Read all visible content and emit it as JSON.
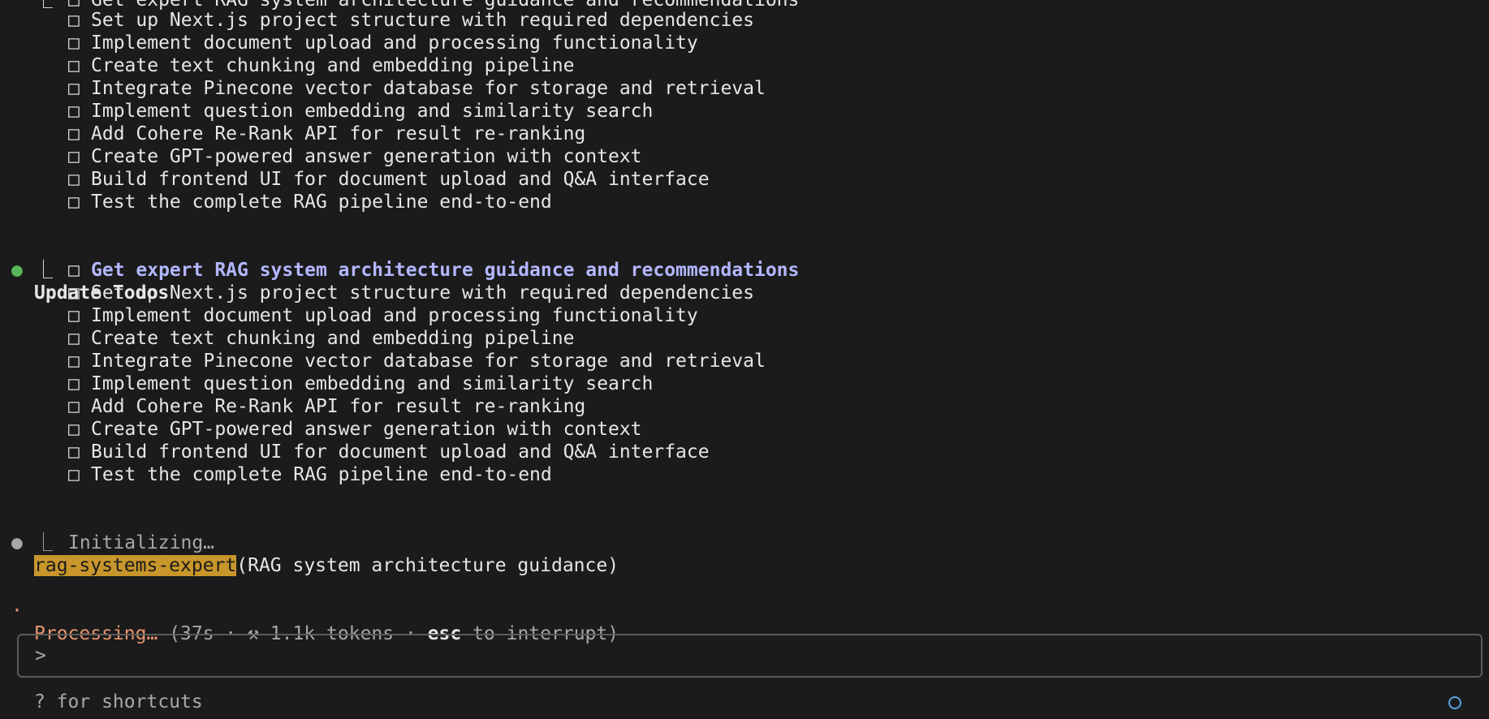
{
  "top_list": {
    "cut_item": "Get expert RAG system architecture guidance and recommendations",
    "items": [
      "Set up Next.js project structure with required dependencies",
      "Implement document upload and processing functionality",
      "Create text chunking and embedding pipeline",
      "Integrate Pinecone vector database for storage and retrieval",
      "Implement question embedding and similarity search",
      "Add Cohere Re-Rank API for result re-ranking",
      "Create GPT-powered answer generation with context",
      "Build frontend UI for document upload and Q&A interface",
      "Test the complete RAG pipeline end-to-end"
    ]
  },
  "update_todos": {
    "bullet": "●",
    "title": "Update Todos",
    "tree": "⎿",
    "checkbox": "□",
    "active_item": "Get expert RAG system architecture guidance and recommendations",
    "items": [
      "Set up Next.js project structure with required dependencies",
      "Implement document upload and processing functionality",
      "Create text chunking and embedding pipeline",
      "Integrate Pinecone vector database for storage and retrieval",
      "Implement question embedding and similarity search",
      "Add Cohere Re-Rank API for result re-ranking",
      "Create GPT-powered answer generation with context",
      "Build frontend UI for document upload and Q&A interface",
      "Test the complete RAG pipeline end-to-end"
    ]
  },
  "agent": {
    "bullet": "●",
    "name": "rag-systems-expert",
    "args": "(RAG system architecture guidance)",
    "status": "Initializing…"
  },
  "processing": {
    "bullet": "·",
    "label": "Processing…",
    "details_pre": " (37s · ⚒ 1.1k tokens · ",
    "key": "esc",
    "details_post": " to interrupt)"
  },
  "input": {
    "prompt": ">",
    "value": ""
  },
  "footer": {
    "hint": "? for shortcuts"
  },
  "colors": {
    "background": "#1b1b1b",
    "text": "#e6e6e6",
    "highlight_item": "#b3b7ff",
    "success_bullet": "#5cb85c",
    "agent_tag_bg": "#c8962a",
    "processing": "#e8956d",
    "indicator": "#5aa0e6"
  },
  "icons": [
    "checkbox-icon",
    "tree-branch-icon",
    "bullet-icon",
    "hammer-icon",
    "status-circle-icon"
  ]
}
